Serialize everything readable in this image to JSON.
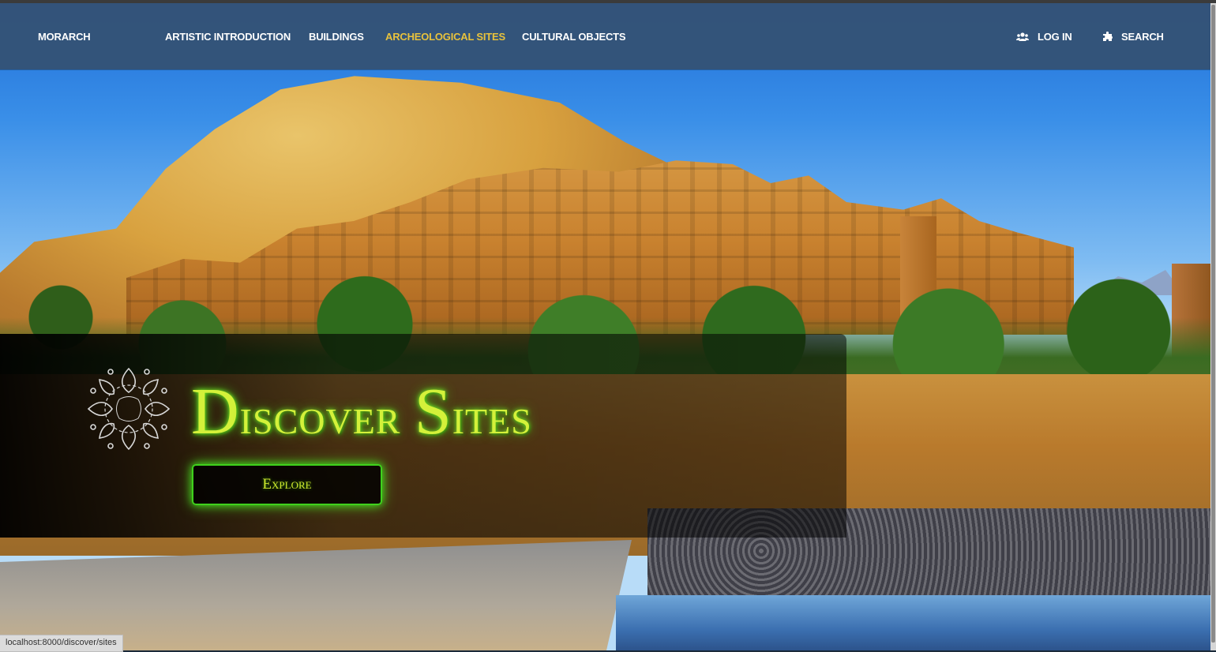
{
  "navbar": {
    "brand": "MORARCH",
    "links": [
      {
        "label": "ARTISTIC INTRODUCTION",
        "active": false
      },
      {
        "label": "BUILDINGS",
        "active": false
      },
      {
        "label": "ARCHEOLOGICAL SITES",
        "active": true
      },
      {
        "label": "CULTURAL OBJECTS",
        "active": false
      }
    ],
    "login_label": "LOG IN",
    "login_icon": "users-icon",
    "search_label": "SEARCH",
    "search_icon": "puzzle-icon"
  },
  "hero": {
    "title_first_letter": "D",
    "title_rest_1": "iscover ",
    "title_second_letter": "S",
    "title_rest_2": "ites",
    "button_label": "Explore",
    "emblem_icon": "ornamental-emblem-icon",
    "background": "kasbah-desert-photo"
  },
  "status_bar": {
    "url": "localhost:8000/discover/sites"
  },
  "colors": {
    "navbar_bg": "#345276",
    "nav_text": "#ffffff",
    "nav_active": "#e8c23c",
    "title_glow": "#7cff2a",
    "title_text": "#d4f13a",
    "button_border": "#3fd11c"
  }
}
